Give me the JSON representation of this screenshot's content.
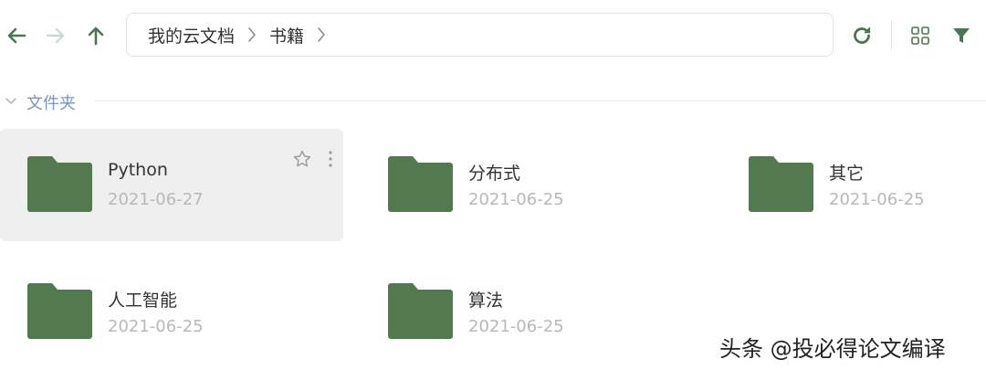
{
  "toolbar": {
    "icons": {
      "back": "arrow-left-icon",
      "forward": "arrow-right-icon",
      "up": "arrow-up-icon",
      "refresh": "refresh-icon",
      "grid": "grid-view-icon",
      "filter": "filter-icon"
    }
  },
  "breadcrumb": {
    "items": [
      {
        "label": "我的云文档"
      },
      {
        "label": "书籍"
      }
    ]
  },
  "section": {
    "title": "文件夹"
  },
  "folders": [
    {
      "name": "Python",
      "date": "2021-06-27",
      "selected": true
    },
    {
      "name": "分布式",
      "date": "2021-06-25",
      "selected": false
    },
    {
      "name": "其它",
      "date": "2021-06-25",
      "selected": false
    },
    {
      "name": "人工智能",
      "date": "2021-06-25",
      "selected": false
    },
    {
      "name": "算法",
      "date": "2021-06-25",
      "selected": false
    }
  ],
  "watermark": "头条 @投必得论文编译",
  "colors": {
    "accent": "#4e7551",
    "folder": "#54784f",
    "nav_disabled": "#c9d6c9",
    "section_label": "#7a95bf",
    "date_text": "#b8b8b8",
    "selected_bg": "#efefef"
  }
}
